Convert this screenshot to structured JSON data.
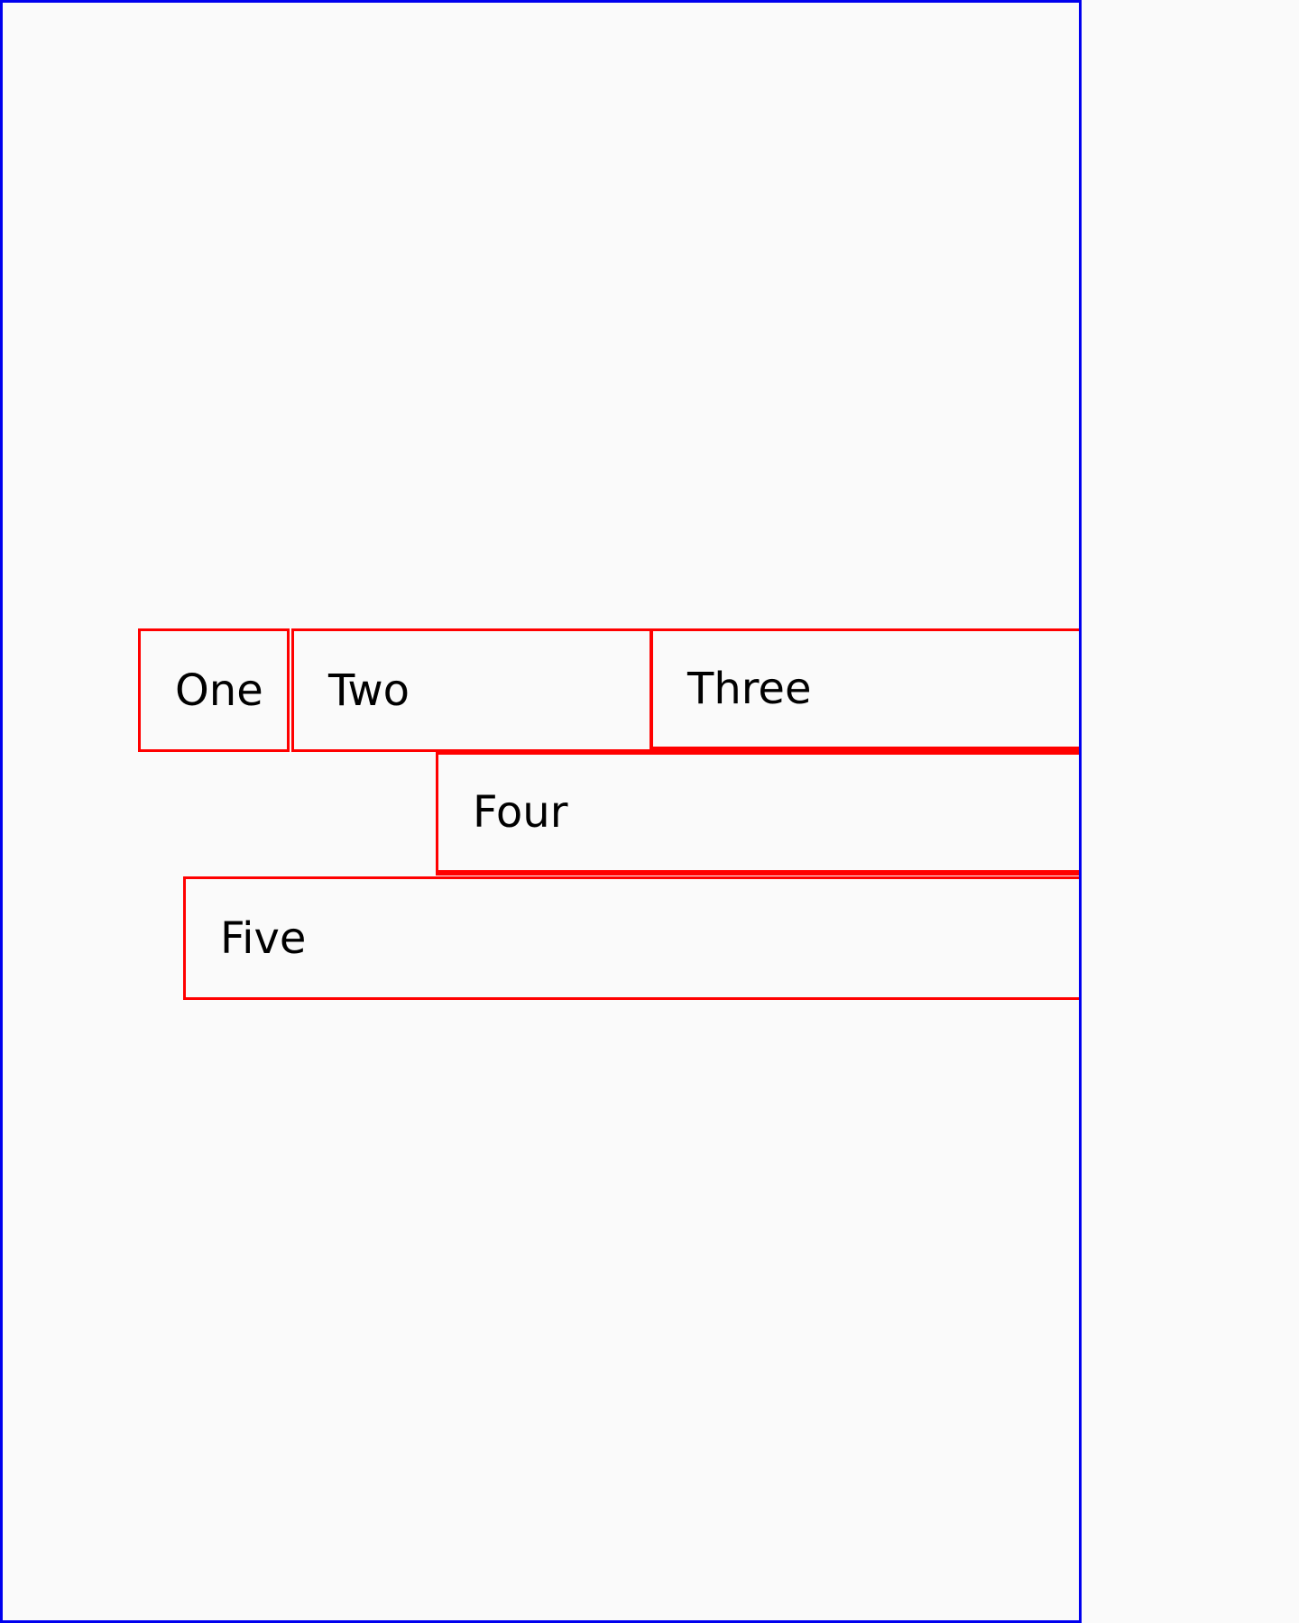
{
  "boxes": {
    "one": "One",
    "two": "Two",
    "three": "Three",
    "four": "Four",
    "five": "Five"
  },
  "colors": {
    "viewport_border": "#0000ee",
    "box_border": "#ff0000",
    "background": "#fafafa",
    "text": "#000000"
  }
}
